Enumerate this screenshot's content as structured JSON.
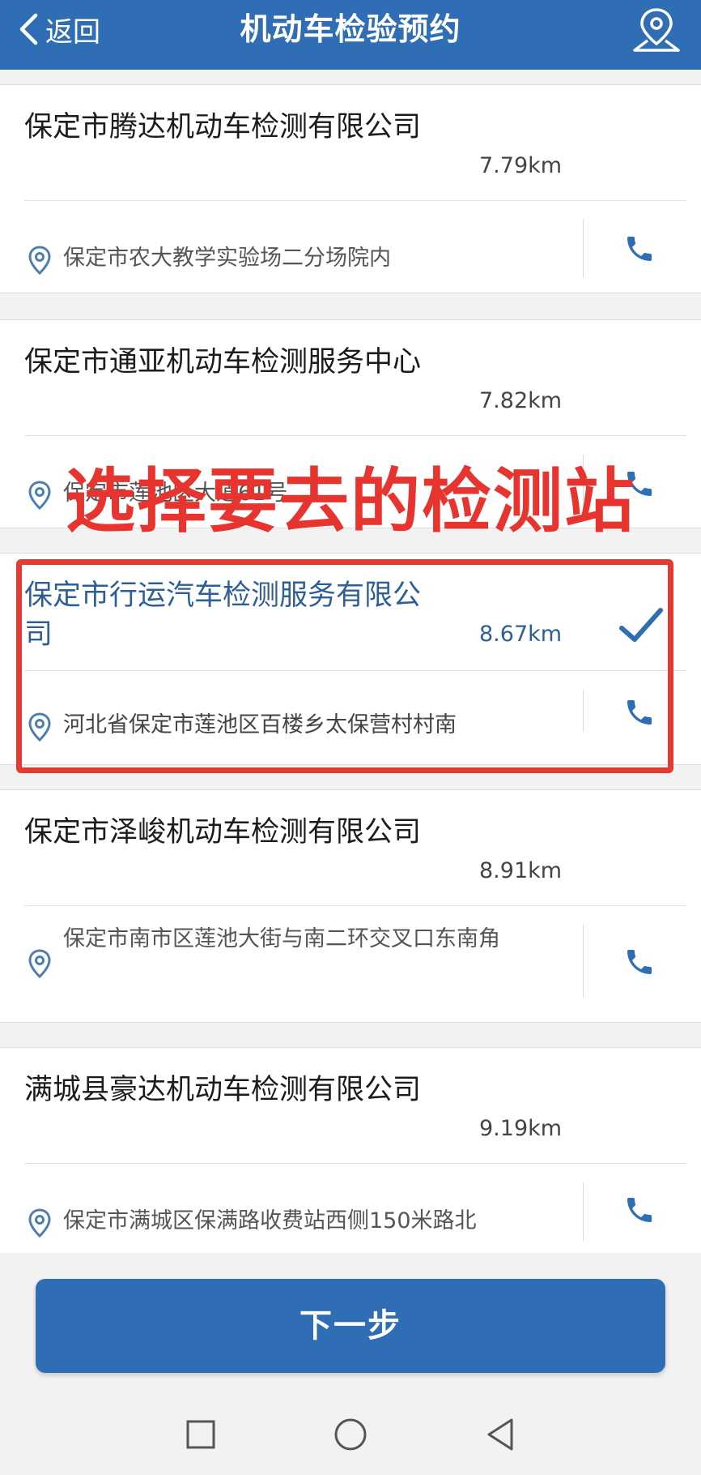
{
  "header": {
    "back_label": "返回",
    "title": "机动车检验预约",
    "location_icon": "location-icon"
  },
  "colors": {
    "primary": "#2f6db5",
    "annotation": "#e8342e",
    "selected_text": "#2d5f96"
  },
  "stations": [
    {
      "name": "保定市腾达机动车检测有限公司",
      "distance": "7.79km",
      "address": "保定市农大教学实验场二分场院内",
      "selected": false
    },
    {
      "name": "保定市通亚机动车检测服务中心",
      "distance": "7.82km",
      "address": "保定市莲池区大道61号",
      "selected": false
    },
    {
      "name": "保定市行运汽车检测服务有限公司",
      "distance": "8.67km",
      "address": "河北省保定市莲池区百楼乡太保营村村南",
      "selected": true
    },
    {
      "name": "保定市泽峻机动车检测有限公司",
      "distance": "8.91km",
      "address": "保定市南市区莲池大街与南二环交叉口东南角",
      "selected": false
    },
    {
      "name": "满城县豪达机动车检测有限公司",
      "distance": "9.19km",
      "address": "保定市满城区保满路收费站西侧150米路北",
      "selected": false
    }
  ],
  "annotation": {
    "text": "选择要去的检测站"
  },
  "footer": {
    "next_label": "下一步"
  }
}
